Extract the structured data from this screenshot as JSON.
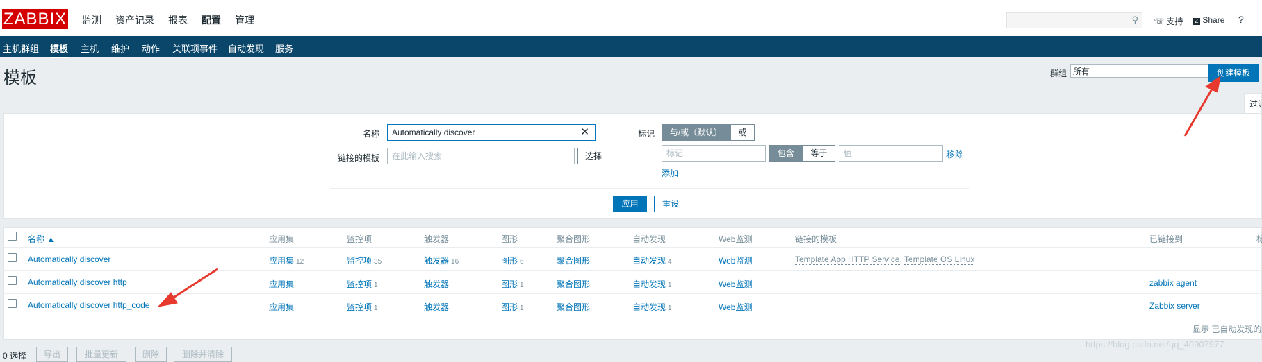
{
  "header": {
    "logo": "ZABBIX",
    "menu": [
      "监测",
      "资产记录",
      "报表",
      "配置",
      "管理"
    ],
    "active_menu": "配置",
    "support": "支持",
    "share": "Share",
    "help": "?"
  },
  "subnav": {
    "items": [
      "主机群组",
      "模板",
      "主机",
      "维护",
      "动作",
      "关联项事件",
      "自动发现",
      "服务"
    ],
    "active": "模板"
  },
  "page": {
    "title": "模板",
    "group_label": "群组",
    "group_value": "所有",
    "create_button": "创建模板",
    "filter_tab": "过滤"
  },
  "filter": {
    "name_label": "名称",
    "name_value": "Automatically discover",
    "linked_label": "链接的模板",
    "linked_placeholder": "在此输入搜索",
    "select_button": "选择",
    "tags_label": "标记",
    "andor": "与/或（默认）",
    "or": "或",
    "tag_placeholder": "标记",
    "contains": "包含",
    "equals": "等于",
    "value_placeholder": "值",
    "remove": "移除",
    "add": "添加",
    "apply": "应用",
    "reset": "重设"
  },
  "table": {
    "headers": {
      "name": "名称 ▲",
      "applications": "应用集",
      "items": "监控项",
      "triggers": "触发器",
      "graphs": "图形",
      "screens": "聚合图形",
      "discovery": "自动发现",
      "web": "Web监测",
      "linked_templates": "链接的模板",
      "linked_to": "已链接到",
      "tags": "标"
    },
    "rows": [
      {
        "name": "Automatically discover",
        "applications": "应用集",
        "applications_count": "12",
        "items": "监控项",
        "items_count": "35",
        "triggers": "触发器",
        "triggers_count": "16",
        "graphs": "图形",
        "graphs_count": "6",
        "screens": "聚合图形",
        "discovery": "自动发现",
        "discovery_count": "4",
        "web": "Web监测",
        "linked_template_1": "Template App HTTP Service",
        "linked_template_sep": ", ",
        "linked_template_2": "Template OS Linux",
        "linked_to": ""
      },
      {
        "name": "Automatically discover http",
        "applications": "应用集",
        "applications_count": "",
        "items": "监控项",
        "items_count": "1",
        "triggers": "触发器",
        "triggers_count": "",
        "graphs": "图形",
        "graphs_count": "1",
        "screens": "聚合图形",
        "discovery": "自动发现",
        "discovery_count": "1",
        "web": "Web监测",
        "linked_template_1": "",
        "linked_template_sep": "",
        "linked_template_2": "",
        "linked_to": "zabbix agent"
      },
      {
        "name": "Automatically discover http_code",
        "applications": "应用集",
        "applications_count": "",
        "items": "监控项",
        "items_count": "1",
        "triggers": "触发器",
        "triggers_count": "",
        "graphs": "图形",
        "graphs_count": "1",
        "screens": "聚合图形",
        "discovery": "自动发现",
        "discovery_count": "1",
        "web": "Web监测",
        "linked_template_1": "",
        "linked_template_sep": "",
        "linked_template_2": "",
        "linked_to": "Zabbix server"
      }
    ],
    "footer": "显示 已自动发现的"
  },
  "actions": {
    "selected": "0 选择",
    "export": "导出",
    "mass_update": "批量更新",
    "delete": "删除",
    "delete_clear": "删除并清除"
  },
  "watermark": "https://blog.csdn.net/qq_40907977",
  "colors": {
    "brand_red": "#d40000",
    "nav_blue": "#0a466a",
    "link_blue": "#0275b8",
    "agent_green": "#429e47",
    "annotation_arrow": "#e8392e"
  }
}
